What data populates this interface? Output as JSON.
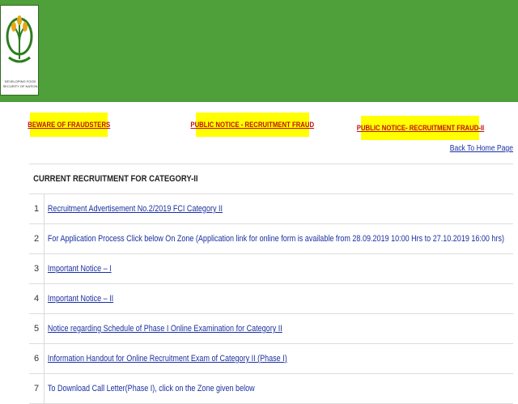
{
  "logo": {
    "caption_line1": "DEVELOPING FOOD",
    "caption_line2": "SECURITY OF NATION"
  },
  "notices": [
    {
      "label": "BEWARE OF FRAUDSTERS"
    },
    {
      "label": "PUBLIC NOTICE - RECRUITMENT FRAUD"
    },
    {
      "label": "PUBLIC NOTICE- RECRUITMENT FRAUD-II"
    }
  ],
  "home_link": "Back To Home Page",
  "section_title": "CURRENT RECRUITMENT FOR CATEGORY-II",
  "rows": [
    {
      "num": "1",
      "text": "Recruitment Advertisement No.2/2019 FCI Category II"
    },
    {
      "num": "2",
      "text": "For Application Process Click below On Zone (Application link for online form is available from 28.09.2019  10:00 Hrs to 27.10.2019  16:00 hrs)"
    },
    {
      "num": "3",
      "text": "Important Notice – I"
    },
    {
      "num": "4",
      "text": "Important Notice – II"
    },
    {
      "num": "5",
      "text": "Notice regarding Schedule of Phase I Online Examination for Category II"
    },
    {
      "num": "6",
      "text": "Information Handout for Online Recruitment Exam of Category II (Phase I)"
    },
    {
      "num": "7",
      "text": "To Download Call Letter(Phase I), click on the Zone given below"
    }
  ],
  "colors": {
    "header_green": "#4f9f3a",
    "notice_yellow": "#ffff00",
    "notice_text": "#c01010",
    "link_blue": "#1a2fa0"
  }
}
